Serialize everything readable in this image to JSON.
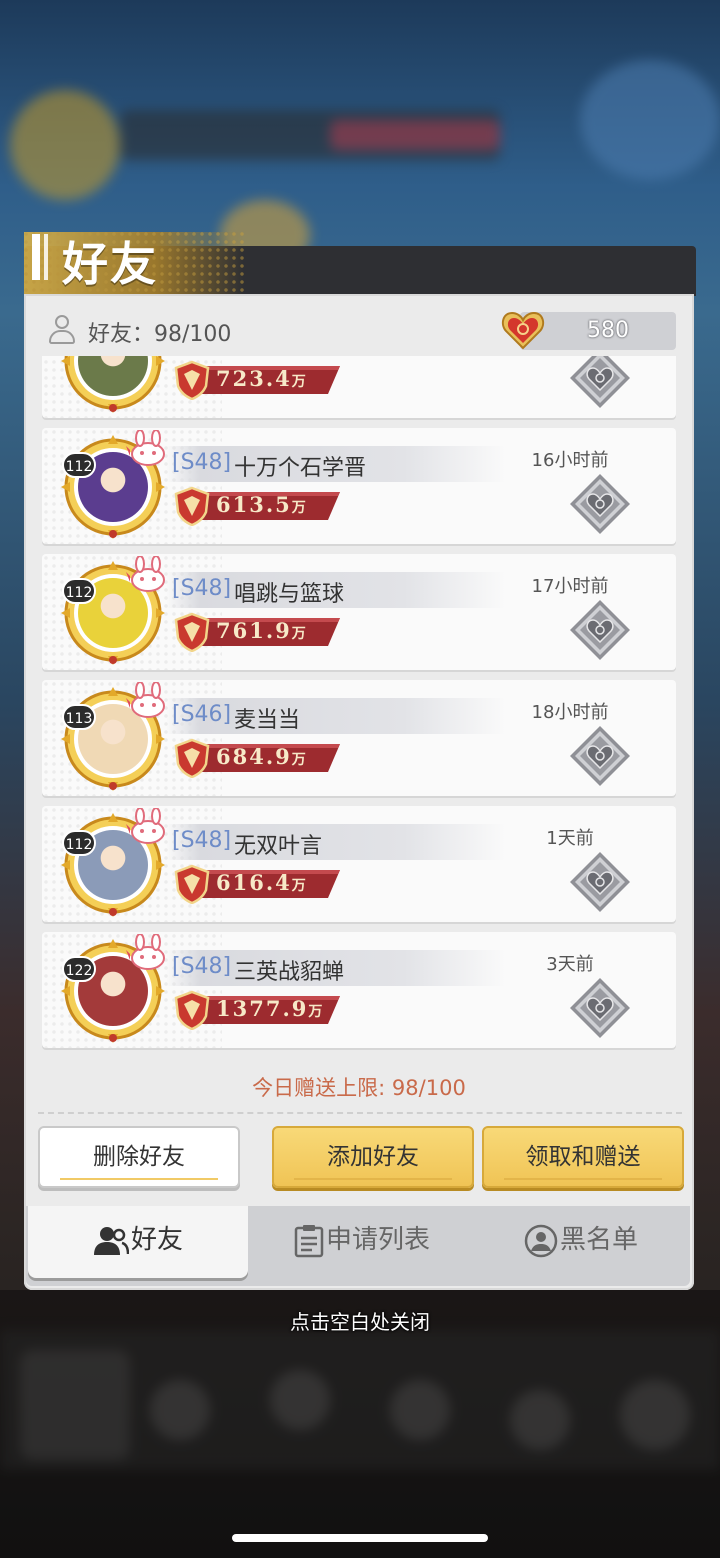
{
  "panel": {
    "title": "好友",
    "friend_count_label": "好友：98/100",
    "hearts": "580"
  },
  "friends": [
    {
      "level": "",
      "server": "",
      "name": "",
      "power": "723.4",
      "power_unit": "万",
      "time": "",
      "avatar_color": "#6b7a4a"
    },
    {
      "level": "112",
      "server": "[S48]",
      "name": "十万个石学晋",
      "power": "613.5",
      "power_unit": "万",
      "time": "16小时前",
      "avatar_color": "#5b3d8f"
    },
    {
      "level": "112",
      "server": "[S48]",
      "name": "唱跳与篮球",
      "power": "761.9",
      "power_unit": "万",
      "time": "17小时前",
      "avatar_color": "#e9d23a"
    },
    {
      "level": "113",
      "server": "[S46]",
      "name": "麦当当",
      "power": "684.9",
      "power_unit": "万",
      "time": "18小时前",
      "avatar_color": "#f0d9b5"
    },
    {
      "level": "112",
      "server": "[S48]",
      "name": "无双叶言",
      "power": "616.4",
      "power_unit": "万",
      "time": "1天前",
      "avatar_color": "#8b9bb8"
    },
    {
      "level": "122",
      "server": "[S48]",
      "name": "三英战貂蝉",
      "power": "1377.9",
      "power_unit": "万",
      "time": "3天前",
      "avatar_color": "#a33a3a"
    }
  ],
  "limit_text": "今日赠送上限: 98/100",
  "buttons": {
    "delete": "删除好友",
    "add": "添加好友",
    "collect_send": "领取和赠送"
  },
  "tabs": {
    "friends": "好友",
    "requests": "申请列表",
    "blacklist": "黑名单"
  },
  "close_hint": "点击空白处关闭",
  "colors": {
    "server_tag": "#6e8cc8",
    "power_bar": "#9d2b2f",
    "limit_text": "#c96a4a",
    "button_yellow": "#f0c455"
  }
}
